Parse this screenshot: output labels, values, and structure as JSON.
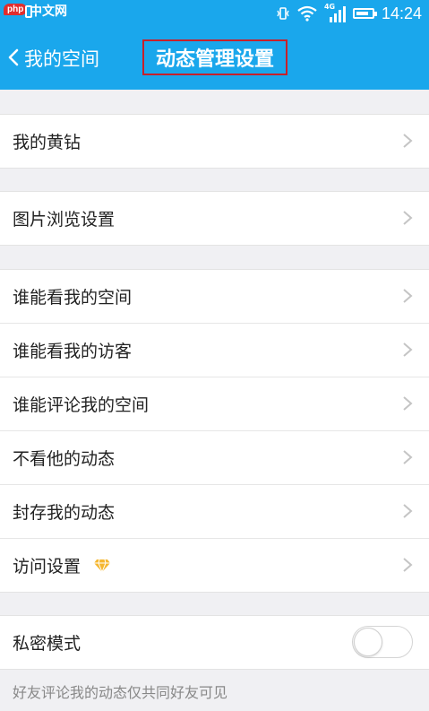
{
  "status_bar": {
    "watermark_badge": "php",
    "watermark_site": "中文网",
    "network_type": "4G",
    "battery_level": 0.8,
    "time": "14:24"
  },
  "nav": {
    "back_label": "我的空间",
    "title": "动态管理设置"
  },
  "groups": [
    {
      "items": [
        {
          "label": "我的黄钻"
        }
      ]
    },
    {
      "items": [
        {
          "label": "图片浏览设置"
        }
      ]
    },
    {
      "items": [
        {
          "label": "谁能看我的空间"
        },
        {
          "label": "谁能看我的访客"
        },
        {
          "label": "谁能评论我的空间"
        },
        {
          "label": "不看他的动态"
        },
        {
          "label": "封存我的动态"
        },
        {
          "label": "访问设置",
          "icon": "diamond-icon"
        }
      ]
    },
    {
      "items": [
        {
          "label": "私密模式",
          "toggle": false
        }
      ]
    }
  ],
  "footer_note": "好友评论我的动态仅共同好友可见",
  "colors": {
    "header": "#1aa7ec",
    "title_border": "#c8202a",
    "diamond": "#f5b731"
  }
}
